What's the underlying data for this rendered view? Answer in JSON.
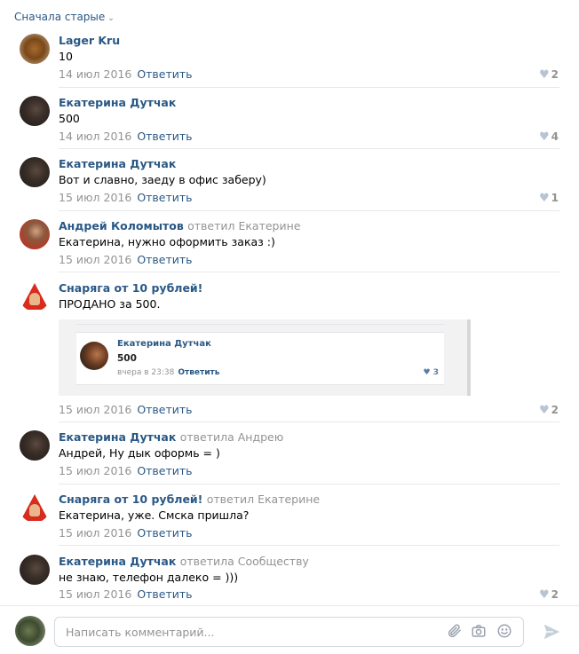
{
  "sort": {
    "label": "Сначала старые"
  },
  "comments": [
    {
      "author": "Lager Kru",
      "reply_to": "",
      "text": "10",
      "date": "14 июл 2016",
      "reply_label": "Ответить",
      "likes": "2"
    },
    {
      "author": "Екатерина Дутчак",
      "reply_to": "",
      "text": "500",
      "date": "14 июл 2016",
      "reply_label": "Ответить",
      "likes": "4"
    },
    {
      "author": "Екатерина Дутчак",
      "reply_to": "",
      "text": "Вот и славно, заеду в офис заберу)",
      "date": "15 июл 2016",
      "reply_label": "Ответить",
      "likes": "1"
    },
    {
      "author": "Андрей Коломытов",
      "reply_to": "ответил Екатерине",
      "text": "Екатерина, нужно оформить заказ :)",
      "date": "15 июл 2016",
      "reply_label": "Ответить",
      "likes": ""
    },
    {
      "author": "Снаряга от 10 рублей!",
      "reply_to": "",
      "text": "ПРОДАНО за 500.",
      "date": "15 июл 2016",
      "reply_label": "Ответить",
      "likes": "2"
    },
    {
      "author": "Екатерина Дутчак",
      "reply_to": "ответила Андрею",
      "text": "Андрей, Ну дык оформь = )",
      "date": "15 июл 2016",
      "reply_label": "Ответить",
      "likes": ""
    },
    {
      "author": "Снаряга от 10 рублей!",
      "reply_to": "ответил Екатерине",
      "text": "Екатерина, уже. Смска пришла?",
      "date": "15 июл 2016",
      "reply_label": "Ответить",
      "likes": ""
    },
    {
      "author": "Екатерина Дутчак",
      "reply_to": "ответила Сообществу",
      "text": "не знаю, телефон далеко = )))",
      "date": "15 июл 2016",
      "reply_label": "Ответить",
      "likes": "2"
    }
  ],
  "embedded": {
    "author": "Екатерина Дутчак",
    "text": "500",
    "time": "вчера в 23:38",
    "reply_label": "Ответить",
    "likes": "3"
  },
  "composer": {
    "placeholder": "Написать комментарий..."
  },
  "icons": {
    "attach": "paperclip-icon",
    "camera": "camera-icon",
    "emoji": "smile-icon",
    "send": "send-icon",
    "heart": "heart-icon"
  },
  "colors": {
    "link": "#2a5885",
    "meta": "#939393",
    "heart": "#b9c4d2"
  }
}
